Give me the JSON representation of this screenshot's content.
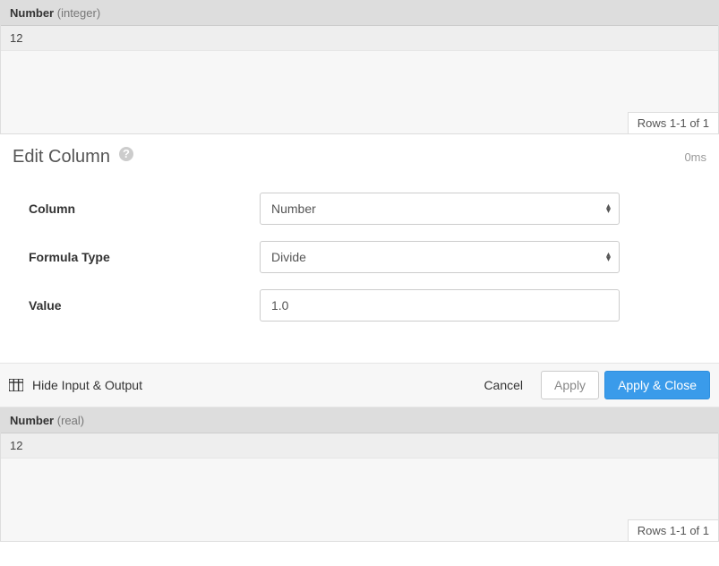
{
  "input_grid": {
    "column_name": "Number",
    "column_type": "(integer)",
    "row_value": "12",
    "footer": "Rows 1-1 of 1"
  },
  "editor": {
    "title": "Edit Column",
    "timing": "0ms",
    "fields": {
      "column": {
        "label": "Column",
        "selected": "Number"
      },
      "formula_type": {
        "label": "Formula Type",
        "selected": "Divide"
      },
      "value": {
        "label": "Value",
        "input": "1.0"
      }
    }
  },
  "actions": {
    "toggle": "Hide Input & Output",
    "cancel": "Cancel",
    "apply": "Apply",
    "apply_close": "Apply & Close"
  },
  "output_grid": {
    "column_name": "Number",
    "column_type": "(real)",
    "row_value": "12",
    "footer": "Rows 1-1 of 1"
  }
}
